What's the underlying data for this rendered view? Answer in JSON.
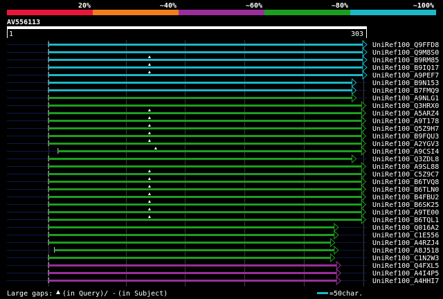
{
  "query": {
    "name": "AV556113",
    "start": "1",
    "end": "303",
    "length": 303
  },
  "identity_scale": {
    "segments": [
      {
        "label": "20%",
        "color": "#e8163c"
      },
      {
        "label": "~40%",
        "color": "#f07d1e"
      },
      {
        "label": "~60%",
        "color": "#9a2e9a"
      },
      {
        "label": "~80%",
        "color": "#1e9e1e"
      },
      {
        "label": "~100%",
        "color": "#1ab8c8"
      }
    ]
  },
  "hits": [
    {
      "id": "UniRef100_Q9FFD8",
      "color": "#1ab8c8",
      "q_start": 35,
      "q_end": 303,
      "gap_query": false,
      "gap_subject": false
    },
    {
      "id": "UniRef100_Q9M8S0",
      "color": "#1ab8c8",
      "q_start": 35,
      "q_end": 303,
      "gap_query": false,
      "gap_subject": false
    },
    {
      "id": "UniRef100_B9RM85",
      "color": "#1ab8c8",
      "q_start": 35,
      "q_end": 303,
      "gap_query": true,
      "gap_subject": false
    },
    {
      "id": "UniRef100_B9IQ17",
      "color": "#1ab8c8",
      "q_start": 35,
      "q_end": 303,
      "gap_query": true,
      "gap_subject": false
    },
    {
      "id": "UniRef100_A9PEF7",
      "color": "#1ab8c8",
      "q_start": 35,
      "q_end": 303,
      "gap_query": true,
      "gap_subject": false
    },
    {
      "id": "UniRef100_B9N153",
      "color": "#1ab8c8",
      "q_start": 35,
      "q_end": 294,
      "gap_query": false,
      "gap_subject": false
    },
    {
      "id": "UniRef100_B7FMQ9",
      "color": "#1ab8c8",
      "q_start": 35,
      "q_end": 294,
      "gap_query": false,
      "gap_subject": false
    },
    {
      "id": "UniRef100_A9NLG1",
      "color": "#1e9e1e",
      "q_start": 35,
      "q_end": 294,
      "gap_query": false,
      "gap_subject": false
    },
    {
      "id": "UniRef100_Q3HRX0",
      "color": "#1e9e1e",
      "q_start": 35,
      "q_end": 302,
      "gap_query": false,
      "gap_subject": false
    },
    {
      "id": "UniRef100_A5ARZ4",
      "color": "#1e9e1e",
      "q_start": 35,
      "q_end": 302,
      "gap_query": true,
      "gap_subject": false
    },
    {
      "id": "UniRef100_A9T178",
      "color": "#1e9e1e",
      "q_start": 35,
      "q_end": 302,
      "gap_query": true,
      "gap_subject": false
    },
    {
      "id": "UniRef100_Q5Z9H7",
      "color": "#1e9e1e",
      "q_start": 35,
      "q_end": 302,
      "gap_query": true,
      "gap_subject": false
    },
    {
      "id": "UniRef100_B9FQU3",
      "color": "#1e9e1e",
      "q_start": 35,
      "q_end": 302,
      "gap_query": true,
      "gap_subject": false
    },
    {
      "id": "UniRef100_A2YGV3",
      "color": "#1e9e1e",
      "q_start": 35,
      "q_end": 302,
      "gap_query": true,
      "gap_subject": false
    },
    {
      "id": "UniRef100_A9CSI4",
      "color": "#1e9e1e",
      "q_start": 43,
      "q_end": 302,
      "gap_query": true,
      "gap_subject": false
    },
    {
      "id": "UniRef100_Q3ZDL8",
      "color": "#1e9e1e",
      "q_start": 35,
      "q_end": 294,
      "gap_query": false,
      "gap_subject": false
    },
    {
      "id": "UniRef100_A9SL88",
      "color": "#1e9e1e",
      "q_start": 35,
      "q_end": 302,
      "gap_query": false,
      "gap_subject": false
    },
    {
      "id": "UniRef100_C5Z9C7",
      "color": "#1e9e1e",
      "q_start": 35,
      "q_end": 302,
      "gap_query": true,
      "gap_subject": false
    },
    {
      "id": "UniRef100_B6TVQ8",
      "color": "#1e9e1e",
      "q_start": 35,
      "q_end": 302,
      "gap_query": true,
      "gap_subject": false
    },
    {
      "id": "UniRef100_B6TLN0",
      "color": "#1e9e1e",
      "q_start": 35,
      "q_end": 302,
      "gap_query": true,
      "gap_subject": false
    },
    {
      "id": "UniRef100_B4FBU2",
      "color": "#1e9e1e",
      "q_start": 35,
      "q_end": 302,
      "gap_query": true,
      "gap_subject": false
    },
    {
      "id": "UniRef100_B6SK25",
      "color": "#1e9e1e",
      "q_start": 35,
      "q_end": 302,
      "gap_query": true,
      "gap_subject": false
    },
    {
      "id": "UniRef100_A9TE00",
      "color": "#1e9e1e",
      "q_start": 35,
      "q_end": 302,
      "gap_query": true,
      "gap_subject": false
    },
    {
      "id": "UniRef100_B6TQL1",
      "color": "#1e9e1e",
      "q_start": 35,
      "q_end": 302,
      "gap_query": true,
      "gap_subject": false
    },
    {
      "id": "UniRef100_Q016A2",
      "color": "#1e9e1e",
      "q_start": 35,
      "q_end": 279,
      "gap_query": false,
      "gap_subject": false
    },
    {
      "id": "UniRef100_C1E556",
      "color": "#1e9e1e",
      "q_start": 35,
      "q_end": 279,
      "gap_query": false,
      "gap_subject": false
    },
    {
      "id": "UniRef100_A4RZJ4",
      "color": "#1e9e1e",
      "q_start": 35,
      "q_end": 276,
      "gap_query": false,
      "gap_subject": false
    },
    {
      "id": "UniRef100_A8J518",
      "color": "#1e9e1e",
      "q_start": 40,
      "q_end": 279,
      "gap_query": false,
      "gap_subject": false
    },
    {
      "id": "UniRef100_C1N2W3",
      "color": "#1e9e1e",
      "q_start": 35,
      "q_end": 276,
      "gap_query": false,
      "gap_subject": false
    },
    {
      "id": "UniRef100_Q4FXL5",
      "color": "#9a2e9a",
      "q_start": 35,
      "q_end": 281,
      "gap_query": false,
      "gap_subject": false
    },
    {
      "id": "UniRef100_A4I4P5",
      "color": "#9a2e9a",
      "q_start": 35,
      "q_end": 281,
      "gap_query": false,
      "gap_subject": false
    },
    {
      "id": "UniRef100_A4HHI7",
      "color": "#9a2e9a",
      "q_start": 35,
      "q_end": 281,
      "gap_query": false,
      "gap_subject": false
    }
  ],
  "legend": {
    "large_gaps_label": "Large gaps:",
    "in_query": "(in Query)/",
    "subject_mark": "-",
    "in_subject": "(in Subject)",
    "scale_label": "=50char."
  }
}
